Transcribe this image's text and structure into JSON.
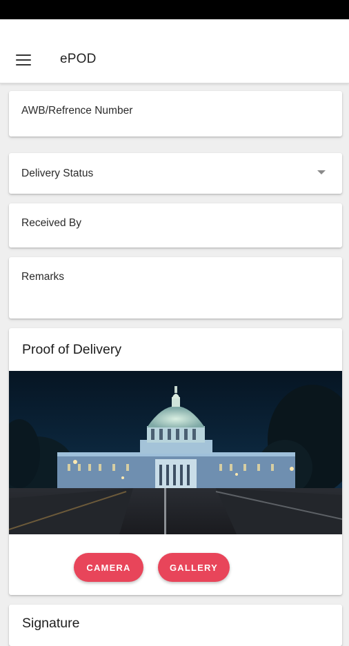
{
  "app": {
    "title": "ePOD"
  },
  "form": {
    "awb_label": "AWB/Refrence Number",
    "delivery_status_label": "Delivery Status",
    "received_by_label": "Received By",
    "remarks_label": "Remarks"
  },
  "proof": {
    "title": "Proof of Delivery",
    "camera_label": "CAMERA",
    "gallery_label": "GALLERY"
  },
  "signature": {
    "title": "Signature"
  },
  "colors": {
    "accent": "#e8455a",
    "background": "#efefef",
    "card": "#ffffff",
    "status_bar": "#000000"
  },
  "icons": {
    "menu": "hamburger-menu-icon",
    "dropdown": "dropdown-arrow-icon"
  }
}
